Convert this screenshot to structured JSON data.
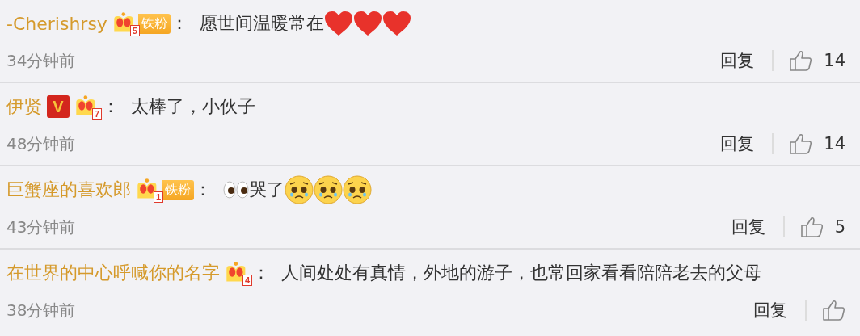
{
  "comments": [
    {
      "user": "-Cherishrsy",
      "level_badge": "5",
      "fan_badge": "铁粉",
      "content": [
        {
          "kind": "text",
          "text": "：  愿世间温暖常在"
        },
        {
          "kind": "heart"
        },
        {
          "kind": "heart"
        },
        {
          "kind": "heart"
        }
      ],
      "time": "34分钟前",
      "reply": "回复",
      "likes": "14"
    },
    {
      "user": "伊贤",
      "vip": "V",
      "level_badge": "7",
      "content": [
        {
          "kind": "text",
          "text": "：  太棒了，小伙子"
        }
      ],
      "time": "48分钟前",
      "reply": "回复",
      "likes": "14"
    },
    {
      "user": "巨蟹座的喜欢郎",
      "level_badge": "1",
      "fan_badge": "铁粉",
      "content": [
        {
          "kind": "text",
          "text": "：  "
        },
        {
          "kind": "eyes"
        },
        {
          "kind": "text",
          "text": "哭了"
        },
        {
          "kind": "sad-face"
        },
        {
          "kind": "sad-face"
        },
        {
          "kind": "sad-face"
        }
      ],
      "time": "43分钟前",
      "reply": "回复",
      "likes": "5"
    },
    {
      "user": "在世界的中心呼喊你的名字",
      "level_badge": "4",
      "content": [
        {
          "kind": "text",
          "text": "：  人间处处有真情，外地的游子，也常回家看看陪陪老去的父母"
        }
      ],
      "time": "38分钟前",
      "reply": "回复"
    }
  ]
}
